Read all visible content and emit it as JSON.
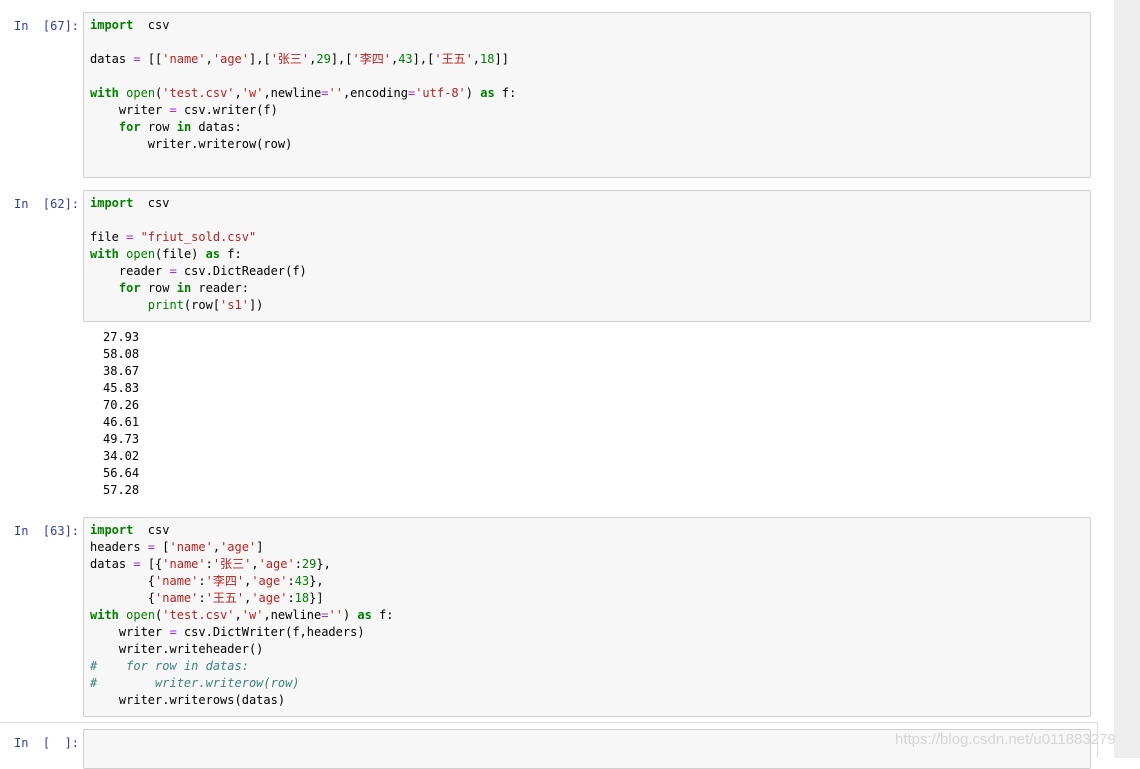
{
  "cells": [
    {
      "prompt": "In  [67]:",
      "lines": [
        [
          [
            "kw",
            "import"
          ],
          [
            "",
            "  csv"
          ]
        ],
        [],
        [
          [
            "",
            "datas "
          ],
          [
            "op",
            "="
          ],
          [
            "",
            " [["
          ],
          [
            "st",
            "'name'"
          ],
          [
            "",
            ","
          ],
          [
            "st",
            "'age'"
          ],
          [
            "",
            "],["
          ],
          [
            "st",
            "'张三'"
          ],
          [
            "",
            ","
          ],
          [
            "nm",
            "29"
          ],
          [
            "",
            "],["
          ],
          [
            "st",
            "'李四'"
          ],
          [
            "",
            ","
          ],
          [
            "nm",
            "43"
          ],
          [
            "",
            "],["
          ],
          [
            "st",
            "'王五'"
          ],
          [
            "",
            ","
          ],
          [
            "nm",
            "18"
          ],
          [
            "",
            "]]"
          ]
        ],
        [],
        [
          [
            "kw",
            "with"
          ],
          [
            "",
            " "
          ],
          [
            "bi",
            "open"
          ],
          [
            "",
            "("
          ],
          [
            "st",
            "'test.csv'"
          ],
          [
            "",
            ","
          ],
          [
            "st",
            "'w'"
          ],
          [
            "",
            ",newline"
          ],
          [
            "op",
            "="
          ],
          [
            "st",
            "''"
          ],
          [
            "",
            ",encoding"
          ],
          [
            "op",
            "="
          ],
          [
            "st",
            "'utf-8'"
          ],
          [
            "",
            ") "
          ],
          [
            "kw",
            "as"
          ],
          [
            "",
            " f:"
          ]
        ],
        [
          [
            "",
            "    writer "
          ],
          [
            "op",
            "="
          ],
          [
            "",
            " csv.writer(f)"
          ]
        ],
        [
          [
            "",
            "    "
          ],
          [
            "kw",
            "for"
          ],
          [
            "",
            " row "
          ],
          [
            "kw",
            "in"
          ],
          [
            "",
            " datas:"
          ]
        ],
        [
          [
            "",
            "        writer.writerow(row)"
          ]
        ],
        []
      ]
    },
    {
      "prompt": "In  [62]:",
      "lines": [
        [
          [
            "kw",
            "import"
          ],
          [
            "",
            "  csv"
          ]
        ],
        [],
        [
          [
            "",
            "file "
          ],
          [
            "op",
            "="
          ],
          [
            "",
            " "
          ],
          [
            "st",
            "\"friut_sold.csv\""
          ]
        ],
        [
          [
            "kw",
            "with"
          ],
          [
            "",
            " "
          ],
          [
            "bi",
            "open"
          ],
          [
            "",
            "(file) "
          ],
          [
            "kw",
            "as"
          ],
          [
            "",
            " f:"
          ]
        ],
        [
          [
            "",
            "    reader "
          ],
          [
            "op",
            "="
          ],
          [
            "",
            " csv.DictReader(f)"
          ]
        ],
        [
          [
            "",
            "    "
          ],
          [
            "kw",
            "for"
          ],
          [
            "",
            " row "
          ],
          [
            "kw",
            "in"
          ],
          [
            "",
            " reader:"
          ]
        ],
        [
          [
            "",
            "        "
          ],
          [
            "bi",
            "print"
          ],
          [
            "",
            "(row["
          ],
          [
            "st",
            "'s1'"
          ],
          [
            "",
            "])"
          ]
        ]
      ],
      "output": [
        "27.93",
        "58.08",
        "38.67",
        "45.83",
        "70.26",
        "46.61",
        "49.73",
        "34.02",
        "56.64",
        "57.28"
      ]
    },
    {
      "prompt": "In  [63]:",
      "lines": [
        [
          [
            "kw",
            "import"
          ],
          [
            "",
            "  csv"
          ]
        ],
        [
          [
            "",
            "headers "
          ],
          [
            "op",
            "="
          ],
          [
            "",
            " ["
          ],
          [
            "st",
            "'name'"
          ],
          [
            "",
            ","
          ],
          [
            "st",
            "'age'"
          ],
          [
            "",
            "]"
          ]
        ],
        [
          [
            "",
            "datas "
          ],
          [
            "op",
            "="
          ],
          [
            "",
            " [{"
          ],
          [
            "st",
            "'name'"
          ],
          [
            "",
            ":"
          ],
          [
            "st",
            "'张三'"
          ],
          [
            "",
            ","
          ],
          [
            "st",
            "'age'"
          ],
          [
            "",
            ":"
          ],
          [
            "nm",
            "29"
          ],
          [
            "",
            "},"
          ]
        ],
        [
          [
            "",
            "        {"
          ],
          [
            "st",
            "'name'"
          ],
          [
            "",
            ":"
          ],
          [
            "st",
            "'李四'"
          ],
          [
            "",
            ","
          ],
          [
            "st",
            "'age'"
          ],
          [
            "",
            ":"
          ],
          [
            "nm",
            "43"
          ],
          [
            "",
            "},"
          ]
        ],
        [
          [
            "",
            "        {"
          ],
          [
            "st",
            "'name'"
          ],
          [
            "",
            ":"
          ],
          [
            "st",
            "'王五'"
          ],
          [
            "",
            ","
          ],
          [
            "st",
            "'age'"
          ],
          [
            "",
            ":"
          ],
          [
            "nm",
            "18"
          ],
          [
            "",
            "}]"
          ]
        ],
        [
          [
            "kw",
            "with"
          ],
          [
            "",
            " "
          ],
          [
            "bi",
            "open"
          ],
          [
            "",
            "("
          ],
          [
            "st",
            "'test.csv'"
          ],
          [
            "",
            ","
          ],
          [
            "st",
            "'w'"
          ],
          [
            "",
            ",newline"
          ],
          [
            "op",
            "="
          ],
          [
            "st",
            "''"
          ],
          [
            "",
            ") "
          ],
          [
            "kw",
            "as"
          ],
          [
            "",
            " f:"
          ]
        ],
        [
          [
            "",
            "    writer "
          ],
          [
            "op",
            "="
          ],
          [
            "",
            " csv.DictWriter(f,headers)"
          ]
        ],
        [
          [
            "",
            "    writer.writeheader()"
          ]
        ],
        [
          [
            "cm",
            "#    for row in datas:"
          ]
        ],
        [
          [
            "cm",
            "#        writer.writerow(row)"
          ]
        ],
        [
          [
            "",
            "    writer.writerows(datas)"
          ]
        ]
      ]
    },
    {
      "prompt": "In  [  ]:",
      "lines": []
    }
  ],
  "watermark": "https://blog.csdn.net/u011883279"
}
